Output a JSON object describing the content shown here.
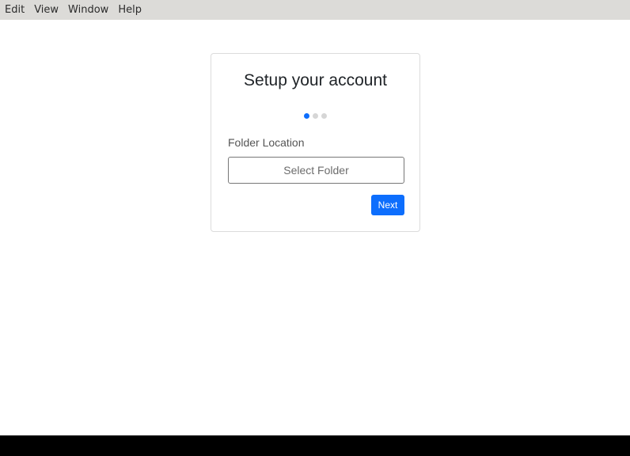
{
  "menubar": {
    "items": [
      {
        "label": "Edit"
      },
      {
        "label": "View"
      },
      {
        "label": "Window"
      },
      {
        "label": "Help"
      }
    ]
  },
  "setup": {
    "title": "Setup your account",
    "steps": {
      "total": 3,
      "current": 1
    },
    "folder_label": "Folder Location",
    "folder_button": "Select Folder",
    "next_button": "Next"
  },
  "colors": {
    "accent": "#0d6efd",
    "menubar_bg": "#dcdbd8",
    "step_inactive": "#d6d6d6"
  }
}
